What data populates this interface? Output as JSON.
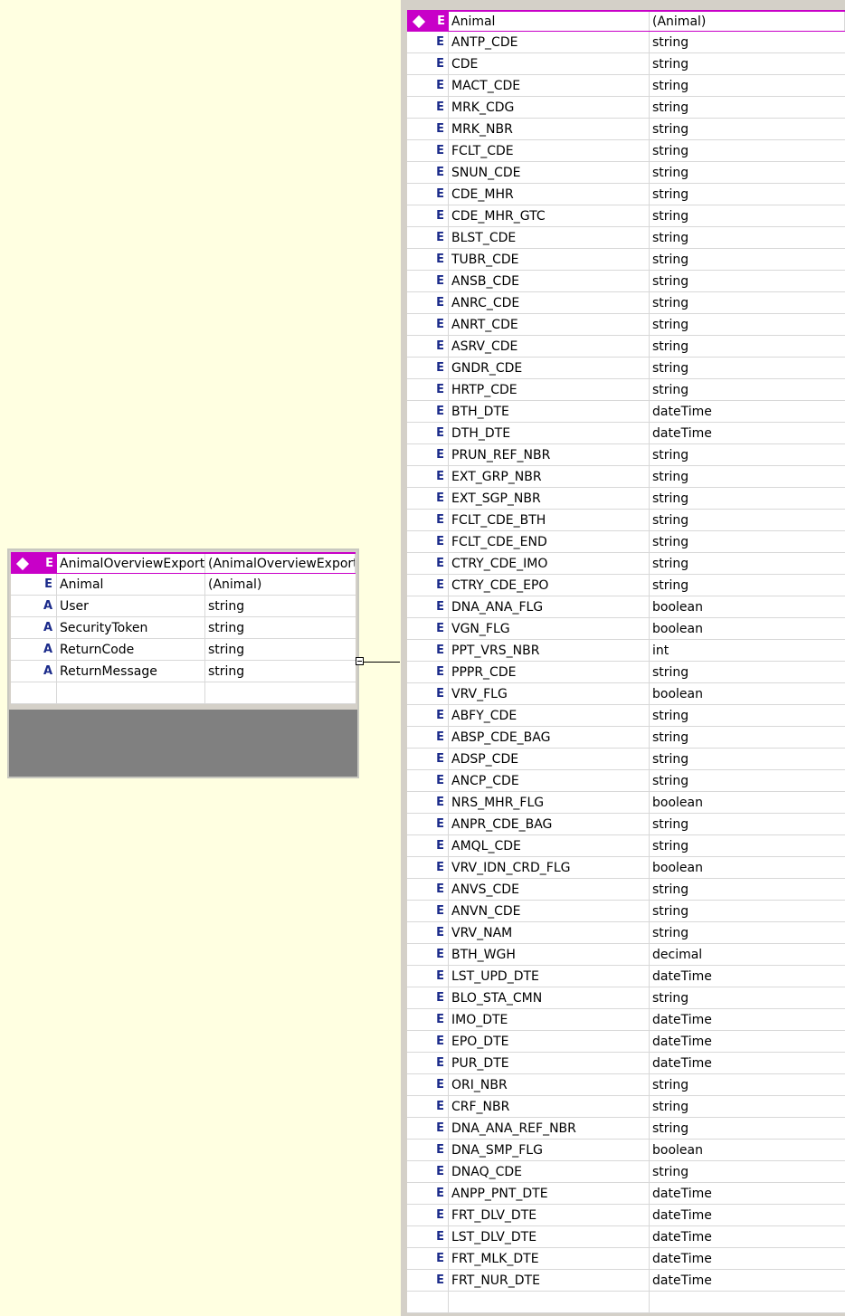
{
  "left_entity": {
    "header": {
      "icon": "E",
      "name": "AnimalOverviewExport",
      "type": "(AnimalOverviewExport"
    },
    "rows": [
      {
        "icon": "E",
        "name": "Animal",
        "type": "(Animal)"
      },
      {
        "icon": "A",
        "name": "User",
        "type": "string"
      },
      {
        "icon": "A",
        "name": "SecurityToken",
        "type": "string"
      },
      {
        "icon": "A",
        "name": "ReturnCode",
        "type": "string"
      },
      {
        "icon": "A",
        "name": "ReturnMessage",
        "type": "string"
      },
      {
        "icon": "",
        "name": "",
        "type": ""
      }
    ]
  },
  "right_entity": {
    "header": {
      "icon": "E",
      "name": "Animal",
      "type": "(Animal)"
    },
    "rows": [
      {
        "icon": "E",
        "name": "ANTP_CDE",
        "type": "string"
      },
      {
        "icon": "E",
        "name": "CDE",
        "type": "string"
      },
      {
        "icon": "E",
        "name": "MACT_CDE",
        "type": "string"
      },
      {
        "icon": "E",
        "name": "MRK_CDG",
        "type": "string"
      },
      {
        "icon": "E",
        "name": "MRK_NBR",
        "type": "string"
      },
      {
        "icon": "E",
        "name": "FCLT_CDE",
        "type": "string"
      },
      {
        "icon": "E",
        "name": "SNUN_CDE",
        "type": "string"
      },
      {
        "icon": "E",
        "name": "CDE_MHR",
        "type": "string"
      },
      {
        "icon": "E",
        "name": "CDE_MHR_GTC",
        "type": "string"
      },
      {
        "icon": "E",
        "name": "BLST_CDE",
        "type": "string"
      },
      {
        "icon": "E",
        "name": "TUBR_CDE",
        "type": "string"
      },
      {
        "icon": "E",
        "name": "ANSB_CDE",
        "type": "string"
      },
      {
        "icon": "E",
        "name": "ANRC_CDE",
        "type": "string"
      },
      {
        "icon": "E",
        "name": "ANRT_CDE",
        "type": "string"
      },
      {
        "icon": "E",
        "name": "ASRV_CDE",
        "type": "string"
      },
      {
        "icon": "E",
        "name": "GNDR_CDE",
        "type": "string"
      },
      {
        "icon": "E",
        "name": "HRTP_CDE",
        "type": "string"
      },
      {
        "icon": "E",
        "name": "BTH_DTE",
        "type": "dateTime"
      },
      {
        "icon": "E",
        "name": "DTH_DTE",
        "type": "dateTime"
      },
      {
        "icon": "E",
        "name": "PRUN_REF_NBR",
        "type": "string"
      },
      {
        "icon": "E",
        "name": "EXT_GRP_NBR",
        "type": "string"
      },
      {
        "icon": "E",
        "name": "EXT_SGP_NBR",
        "type": "string"
      },
      {
        "icon": "E",
        "name": "FCLT_CDE_BTH",
        "type": "string"
      },
      {
        "icon": "E",
        "name": "FCLT_CDE_END",
        "type": "string"
      },
      {
        "icon": "E",
        "name": "CTRY_CDE_IMO",
        "type": "string"
      },
      {
        "icon": "E",
        "name": "CTRY_CDE_EPO",
        "type": "string"
      },
      {
        "icon": "E",
        "name": "DNA_ANA_FLG",
        "type": "boolean"
      },
      {
        "icon": "E",
        "name": "VGN_FLG",
        "type": "boolean"
      },
      {
        "icon": "E",
        "name": "PPT_VRS_NBR",
        "type": "int"
      },
      {
        "icon": "E",
        "name": "PPPR_CDE",
        "type": "string"
      },
      {
        "icon": "E",
        "name": "VRV_FLG",
        "type": "boolean"
      },
      {
        "icon": "E",
        "name": "ABFY_CDE",
        "type": "string"
      },
      {
        "icon": "E",
        "name": "ABSP_CDE_BAG",
        "type": "string"
      },
      {
        "icon": "E",
        "name": "ADSP_CDE",
        "type": "string"
      },
      {
        "icon": "E",
        "name": "ANCP_CDE",
        "type": "string"
      },
      {
        "icon": "E",
        "name": "NRS_MHR_FLG",
        "type": "boolean"
      },
      {
        "icon": "E",
        "name": "ANPR_CDE_BAG",
        "type": "string"
      },
      {
        "icon": "E",
        "name": "AMQL_CDE",
        "type": "string"
      },
      {
        "icon": "E",
        "name": "VRV_IDN_CRD_FLG",
        "type": "boolean"
      },
      {
        "icon": "E",
        "name": "ANVS_CDE",
        "type": "string"
      },
      {
        "icon": "E",
        "name": "ANVN_CDE",
        "type": "string"
      },
      {
        "icon": "E",
        "name": "VRV_NAM",
        "type": "string"
      },
      {
        "icon": "E",
        "name": "BTH_WGH",
        "type": "decimal"
      },
      {
        "icon": "E",
        "name": "LST_UPD_DTE",
        "type": "dateTime"
      },
      {
        "icon": "E",
        "name": "BLO_STA_CMN",
        "type": "string"
      },
      {
        "icon": "E",
        "name": "IMO_DTE",
        "type": "dateTime"
      },
      {
        "icon": "E",
        "name": "EPO_DTE",
        "type": "dateTime"
      },
      {
        "icon": "E",
        "name": "PUR_DTE",
        "type": "dateTime"
      },
      {
        "icon": "E",
        "name": "ORI_NBR",
        "type": "string"
      },
      {
        "icon": "E",
        "name": "CRF_NBR",
        "type": "string"
      },
      {
        "icon": "E",
        "name": "DNA_ANA_REF_NBR",
        "type": "string"
      },
      {
        "icon": "E",
        "name": "DNA_SMP_FLG",
        "type": "boolean"
      },
      {
        "icon": "E",
        "name": "DNAQ_CDE",
        "type": "string"
      },
      {
        "icon": "E",
        "name": "ANPP_PNT_DTE",
        "type": "dateTime"
      },
      {
        "icon": "E",
        "name": "FRT_DLV_DTE",
        "type": "dateTime"
      },
      {
        "icon": "E",
        "name": "LST_DLV_DTE",
        "type": "dateTime"
      },
      {
        "icon": "E",
        "name": "FRT_MLK_DTE",
        "type": "dateTime"
      },
      {
        "icon": "E",
        "name": "FRT_NUR_DTE",
        "type": "dateTime"
      },
      {
        "icon": "",
        "name": "",
        "type": ""
      }
    ]
  },
  "colors": {
    "canvas_background": "#ffffe1",
    "header_accent": "#c800c8",
    "entity_frame": "#d4d0c8",
    "icon_text": "#1a2a8a"
  },
  "icons": {
    "element_badge": "E",
    "attribute_badge": "A",
    "header_marker": "diamond-icon",
    "connector_toggle": "collapse-icon"
  }
}
